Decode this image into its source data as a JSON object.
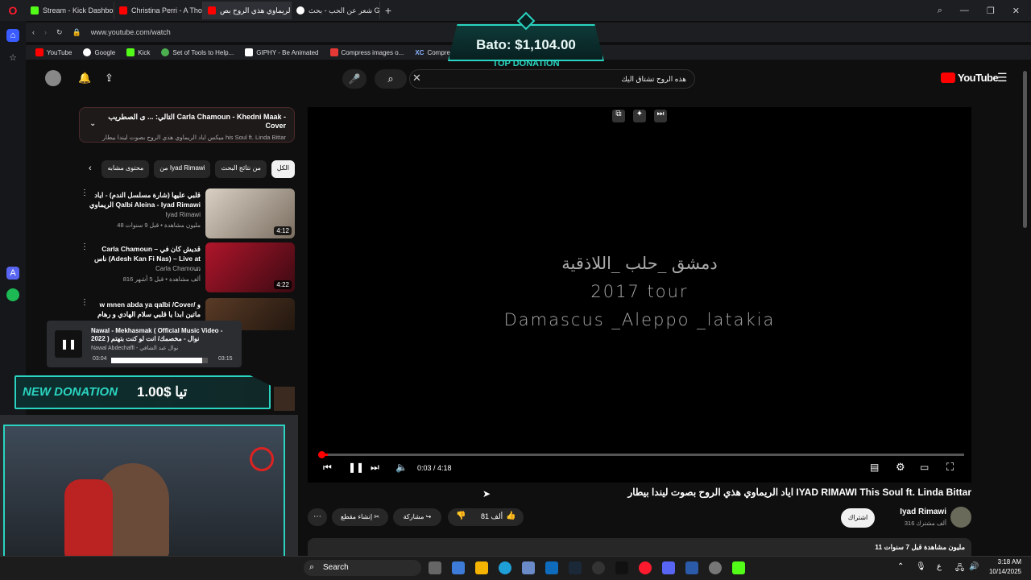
{
  "browser": {
    "tabs": [
      {
        "label": "Stream - Kick Dashboard",
        "color": "#53fc18"
      },
      {
        "label": "Christina Perri - A Thousan",
        "color": "#ff0000"
      },
      {
        "label": "اياد الريماوي هذي الروح بص",
        "color": "#ff0000",
        "active": true
      },
      {
        "label": "شعر عن الحب - بحث Google",
        "color": "#ffffff"
      }
    ],
    "url": "www.youtube.com/watch",
    "bookmarks": [
      "YouTube",
      "Google",
      "Kick",
      "Set of Tools to Help...",
      "GIPHY - Be Animated",
      "Compress images o...",
      "Compres"
    ]
  },
  "youtube": {
    "logo": "YouTube",
    "search_value": "هذه الروح تشتاق اليك",
    "up_next": {
      "title": "التالي: ... ى الصطريب Carla Chamoun - Khedni Maak - Cover",
      "subtitle": "ميكس اياد الريماوي هذي الروح بصوت ليندا بيطار his Soul ft. Linda Bittar"
    },
    "chips": [
      "الكل",
      "من نتائج البحث",
      "من Iyad Rimawi",
      "محتوى مشابه"
    ],
    "recommendations": [
      {
        "title": "قلبي عليها (شارة مسلسل الندم) - اياد الريماوي Qalbi Aleina - Iyad Rimawi",
        "channel": "Iyad Rimawi",
        "meta": "48 مليون مشاهدة • قبل 9 سنوات",
        "duration": "4:12"
      },
      {
        "title": "Carla Chamoun – قديش كان في ناس (Adesh Kan Fi Nas) – Live at ...",
        "channel": "Carla Chamoun",
        "meta": "816 ألف مشاهدة • قبل 5 أشهر",
        "duration": "4:22"
      },
      {
        "title": "w mnen abda ya qalbi /Cover/ و ماتين ابدا يا قلبي سلام الهادي و رهام مسلماني",
        "channel": "",
        "meta": "",
        "duration": ""
      }
    ],
    "video": {
      "overlay_lines": [
        "دمشق _حلب _اللاذقية",
        "2017 tour",
        "Damascus _Aleppo _latakia"
      ],
      "time": "0:03 / 4:18",
      "progress": 0.012,
      "title": "اياد الريماوي هذي الروح بصوت ليندا بيطار IYAD RIMAWI This Soul ft. Linda Bittar",
      "channel": "Iyad Rimawi",
      "subs": "316 ألف مشترك",
      "subscribe": "اشتراك",
      "likes": "81 ألف",
      "share": "مشاركة",
      "clip": "إنشاء مقطع",
      "views": "11 مليون مشاهدة قبل 7 سنوات"
    }
  },
  "overlays": {
    "top_donation_amount": "Bato: $1,104.00",
    "top_donation_label": "TOP DONATION",
    "new_donation_label": "NEW DONATION",
    "new_donation_amount": "1.00$ تيا",
    "music": {
      "title": "Nawal - Mekhasmak ( Official Music Video - 2022 ) نوال - مخصمك/ انت لو كنت بتهتم",
      "artist": "Nawal Abdechaffi - نوال عبد الشافي",
      "elapsed": "03:04",
      "total": "03:15",
      "progress": 0.94
    }
  },
  "taskbar": {
    "search": "Search",
    "time": "3:18 AM",
    "date": "10/14/2025",
    "lang": "ع"
  }
}
